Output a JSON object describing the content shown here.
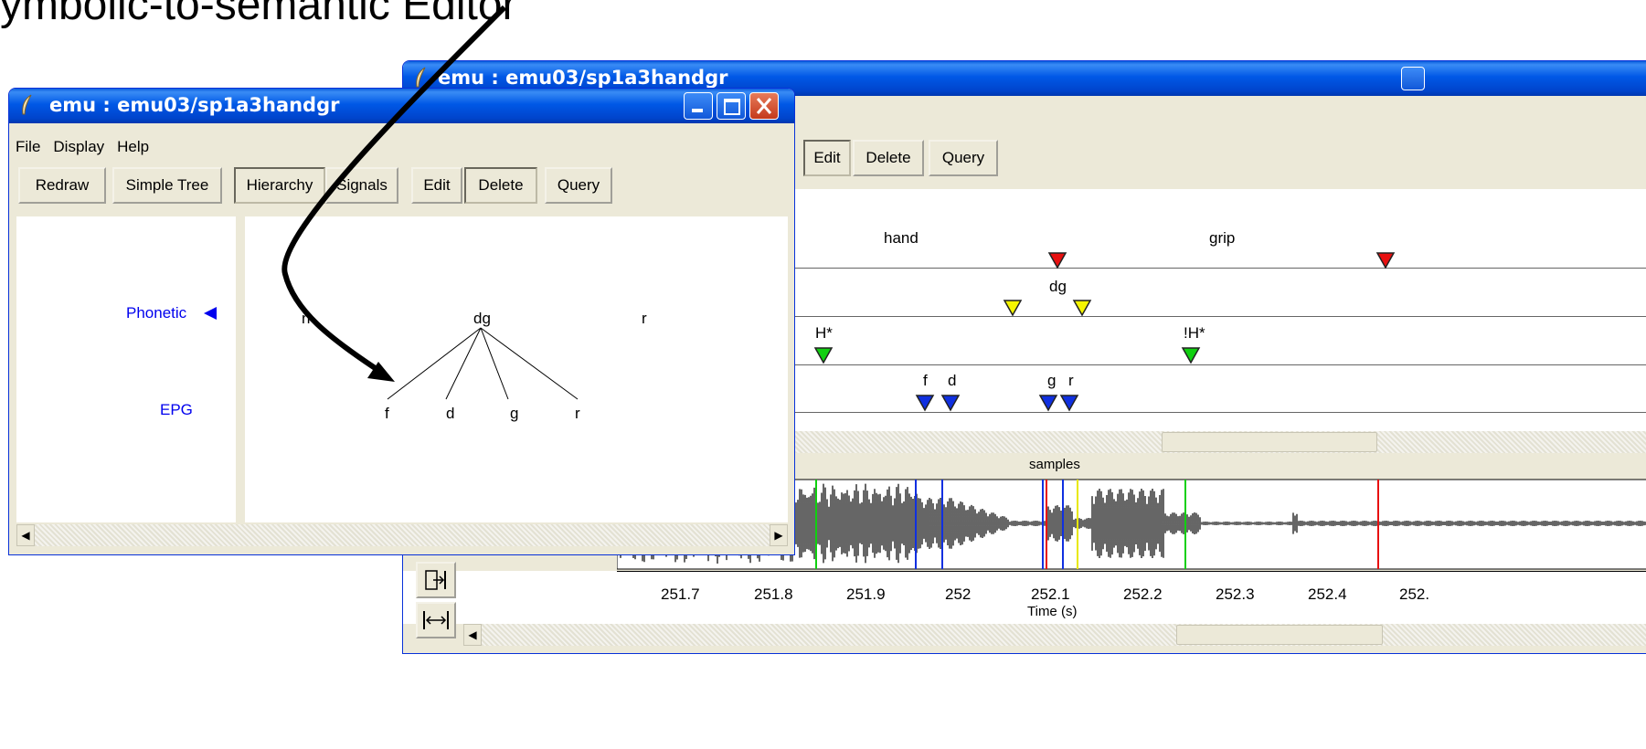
{
  "headline": "ymbolic-to-semantic Editor",
  "back_window": {
    "title": "emu : emu03/sp1a3handgr",
    "toolbar": {
      "edit": "Edit",
      "delete": "Delete",
      "query": "Query"
    },
    "tiers": {
      "words": [
        "hand",
        "grip"
      ],
      "phonetic": [
        "dg"
      ],
      "tones": [
        "H*",
        "!H*"
      ],
      "epg": [
        "f",
        "d",
        "g",
        "r"
      ]
    },
    "samples_label": "samples",
    "axis": {
      "ticks": [
        "251.7",
        "251.8",
        "251.9",
        "252",
        "252.1",
        "252.2",
        "252.3",
        "252.4",
        "252."
      ],
      "label": "Time (s)"
    }
  },
  "front_window": {
    "title": "emu : emu03/sp1a3handgr",
    "menu": [
      "File",
      "Display",
      "Help"
    ],
    "toolbar": [
      "Redraw",
      "Simple Tree",
      "Hierarchy",
      "Signals",
      "Edit",
      "Delete",
      "Query"
    ],
    "tier_labels": {
      "phonetic": "Phonetic",
      "epg": "EPG"
    },
    "tree": {
      "root": "dg",
      "left": "n",
      "right": "r",
      "children": [
        "f",
        "d",
        "g",
        "r"
      ]
    }
  },
  "colors": {
    "marker_red": "#e81010",
    "marker_yellow": "#f5f500",
    "marker_green": "#10d010",
    "marker_blue": "#1030e0",
    "label_blue": "#0000ee"
  }
}
